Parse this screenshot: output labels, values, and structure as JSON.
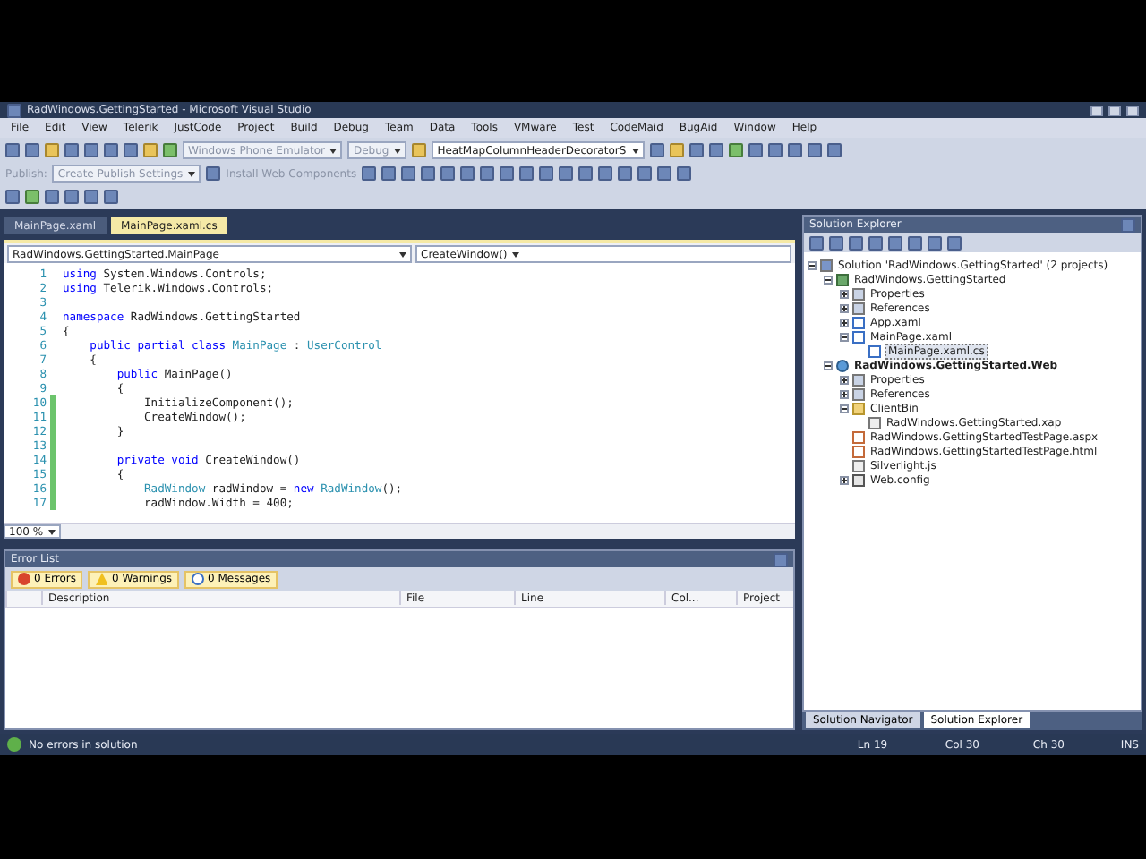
{
  "window": {
    "title": "RadWindows.GettingStarted - Microsoft Visual Studio"
  },
  "menu": [
    "File",
    "Edit",
    "View",
    "Telerik",
    "JustCode",
    "Project",
    "Build",
    "Debug",
    "Team",
    "Data",
    "Tools",
    "VMware",
    "Test",
    "CodeMaid",
    "BugAid",
    "Window",
    "Help"
  ],
  "toolbar": {
    "target": "Windows Phone Emulator",
    "configuration": "Debug",
    "find": "HeatMapColumnHeaderDecoratorS",
    "publish_label": "Publish:",
    "publish": "Create Publish Settings",
    "install": "Install Web Components"
  },
  "editor": {
    "tabs": [
      {
        "label": "MainPage.xaml",
        "selected": false
      },
      {
        "label": "MainPage.xaml.cs",
        "selected": true
      }
    ],
    "type_nav": "RadWindows.GettingStarted.MainPage",
    "member_nav": "CreateWindow()",
    "zoom": "100 %",
    "lines": [
      {
        "number": "1",
        "changed": false,
        "tokens": [
          {
            "kind": "keyword",
            "text": "using"
          },
          {
            "kind": "plain",
            "text": " System.Windows.Controls;"
          }
        ]
      },
      {
        "number": "2",
        "changed": false,
        "tokens": [
          {
            "kind": "keyword",
            "text": "using"
          },
          {
            "kind": "plain",
            "text": " Telerik.Windows.Controls;"
          }
        ]
      },
      {
        "number": "3",
        "changed": false
      },
      {
        "number": "4",
        "changed": false,
        "tokens": [
          {
            "kind": "keyword",
            "text": "namespace"
          },
          {
            "kind": "plain",
            "text": " RadWindows.GettingStarted"
          }
        ]
      },
      {
        "number": "5",
        "changed": false,
        "tokens": [
          {
            "kind": "plain",
            "text": "{"
          }
        ]
      },
      {
        "number": "6",
        "changed": false,
        "tokens": [
          {
            "kind": "keyword",
            "text": "    public partial class"
          },
          {
            "kind": "type",
            "text": " MainPage"
          },
          {
            "kind": "plain",
            "text": " : "
          },
          {
            "kind": "type",
            "text": "UserControl"
          }
        ]
      },
      {
        "number": "7",
        "changed": false,
        "tokens": [
          {
            "kind": "plain",
            "text": "    {"
          }
        ]
      },
      {
        "number": "8",
        "changed": false,
        "tokens": [
          {
            "kind": "keyword",
            "text": "        public"
          },
          {
            "kind": "plain",
            "text": " MainPage()"
          }
        ]
      },
      {
        "number": "9",
        "changed": false,
        "tokens": [
          {
            "kind": "plain",
            "text": "        {"
          }
        ]
      },
      {
        "number": "10",
        "changed": true,
        "tokens": [
          {
            "kind": "plain",
            "text": "            InitializeComponent();"
          }
        ]
      },
      {
        "number": "11",
        "changed": true,
        "tokens": [
          {
            "kind": "plain",
            "text": "            CreateWindow();"
          }
        ]
      },
      {
        "number": "12",
        "changed": true,
        "tokens": [
          {
            "kind": "plain",
            "text": "        }"
          }
        ]
      },
      {
        "number": "13",
        "changed": true
      },
      {
        "number": "14",
        "changed": true,
        "tokens": [
          {
            "kind": "keyword",
            "text": "        private void"
          },
          {
            "kind": "plain",
            "text": " CreateWindow()"
          }
        ]
      },
      {
        "number": "15",
        "changed": true,
        "tokens": [
          {
            "kind": "plain",
            "text": "        {"
          }
        ]
      },
      {
        "number": "16",
        "changed": true,
        "tokens": [
          {
            "kind": "type",
            "text": "            RadWindow"
          },
          {
            "kind": "plain",
            "text": " radWindow = "
          },
          {
            "kind": "keyword",
            "text": "new"
          },
          {
            "kind": "type",
            "text": " RadWindow"
          },
          {
            "kind": "plain",
            "text": "();"
          }
        ]
      },
      {
        "number": "17",
        "changed": true,
        "tokens": [
          {
            "kind": "plain",
            "text": "            radWindow.Width = 400;"
          }
        ]
      }
    ]
  },
  "error_list": {
    "title": "Error List",
    "filters": [
      {
        "kind": "error",
        "label": "0 Errors",
        "on": true
      },
      {
        "kind": "warning",
        "label": "0 Warnings",
        "on": true
      },
      {
        "kind": "message",
        "label": "0 Messages",
        "on": true
      }
    ],
    "columns": [
      "Description",
      "File",
      "Line",
      "Col...",
      "Project"
    ]
  },
  "solution_explorer": {
    "title": "Solution Explorer",
    "tree": [
      {
        "kind": "solution",
        "label": "Solution 'RadWindows.GettingStarted' (2 projects)",
        "expanded": true,
        "selected": false,
        "startup": false,
        "children": [
          {
            "kind": "project",
            "label": "RadWindows.GettingStarted",
            "expanded": true,
            "selected": false,
            "startup": false,
            "children": [
              {
                "kind": "properties",
                "label": "Properties",
                "expanded": false,
                "selected": false,
                "startup": false
              },
              {
                "kind": "references",
                "label": "References",
                "expanded": false,
                "selected": false,
                "startup": false
              },
              {
                "kind": "xaml",
                "label": "App.xaml",
                "expanded": false,
                "selected": false,
                "startup": false
              },
              {
                "kind": "xaml",
                "label": "MainPage.xaml",
                "expanded": true,
                "selected": false,
                "startup": false,
                "children": [
                  {
                    "kind": "code",
                    "label": "MainPage.xaml.cs",
                    "selected": true,
                    "startup": false
                  }
                ]
              }
            ]
          },
          {
            "kind": "web",
            "label": "RadWindows.GettingStarted.Web",
            "expanded": true,
            "selected": false,
            "startup": true,
            "children": [
              {
                "kind": "properties",
                "label": "Properties",
                "expanded": false,
                "selected": false,
                "startup": false
              },
              {
                "kind": "references",
                "label": "References",
                "expanded": false,
                "selected": false,
                "startup": false
              },
              {
                "kind": "folder",
                "label": "ClientBin",
                "expanded": true,
                "selected": false,
                "startup": false,
                "children": [
                  {
                    "kind": "file",
                    "label": "RadWindows.GettingStarted.xap",
                    "selected": false,
                    "startup": false
                  }
                ]
              },
              {
                "kind": "page",
                "label": "RadWindows.GettingStartedTestPage.aspx",
                "selected": false,
                "startup": false
              },
              {
                "kind": "page",
                "label": "RadWindows.GettingStartedTestPage.html",
                "selected": false,
                "startup": false
              },
              {
                "kind": "file",
                "label": "Silverlight.js",
                "selected": false,
                "startup": false
              },
              {
                "kind": "config",
                "label": "Web.config",
                "expanded": false,
                "selected": false,
                "startup": false
              }
            ]
          }
        ]
      }
    ],
    "bottom_tabs": [
      {
        "label": "Solution Navigator",
        "selected": false
      },
      {
        "label": "Solution Explorer",
        "selected": true
      }
    ]
  },
  "status_bar": {
    "message": "No errors in solution",
    "line": "Ln 19",
    "col": "Col 30",
    "ch": "Ch 30",
    "mode": "INS"
  }
}
